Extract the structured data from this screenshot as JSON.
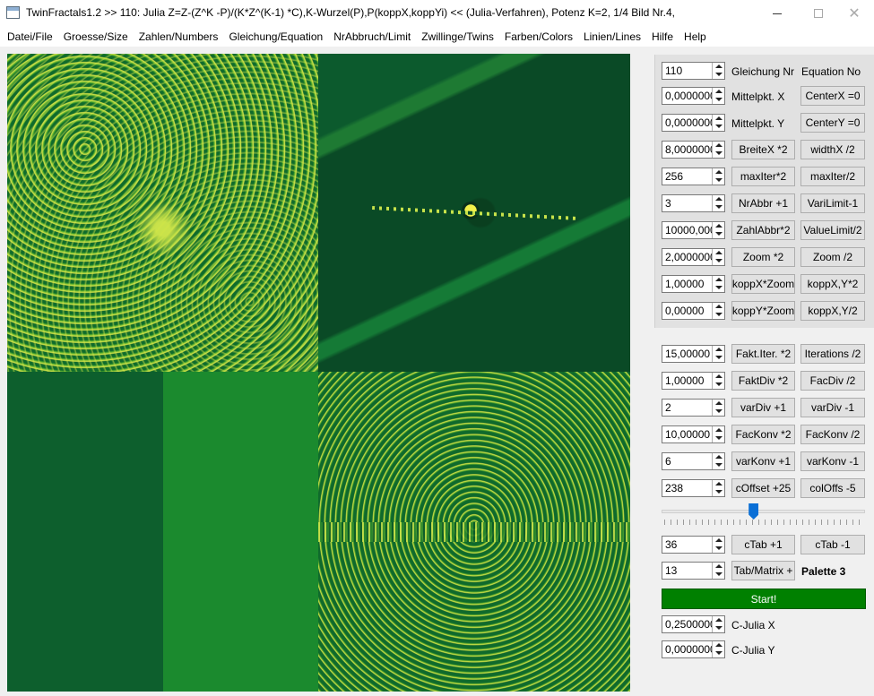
{
  "window": {
    "title": "TwinFractals1.2 >> 110: Julia Z=Z-(Z^K -P)/(K*Z^(K-1) *C),K-Wurzel(P),P(koppX,koppYi)  << (Julia-Verfahren), Potenz K=2, 1/4 Bild Nr.4,",
    "minimize": "—",
    "close": "✕"
  },
  "menu": [
    "Datei/File",
    "Groesse/Size",
    "Zahlen/Numbers",
    "Gleichung/Equation",
    "NrAbbruch/Limit",
    "Zwillinge/Twins",
    "Farben/Colors",
    "Linien/Lines",
    "Hilfe",
    "Help"
  ],
  "rows1": [
    {
      "value": "110",
      "label": "Gleichung Nr",
      "label2": "Equation No"
    },
    {
      "value": "0,0000000",
      "label": "Mittelpkt. X",
      "btn2": "CenterX =0"
    },
    {
      "value": "0,0000000",
      "label": "Mittelpkt. Y",
      "btn2": "CenterY =0"
    },
    {
      "value": "8,0000000",
      "btn1": "BreiteX *2",
      "btn2": "widthX /2"
    },
    {
      "value": "256",
      "btn1": "maxIter*2",
      "btn2": "maxIter/2"
    },
    {
      "value": "3",
      "btn1": "NrAbbr +1",
      "btn2": "VariLimit-1"
    },
    {
      "value": "10000,000",
      "btn1": "ZahlAbbr*2",
      "btn2": "ValueLimit/2"
    },
    {
      "value": "2,0000000",
      "btn1": "Zoom *2",
      "btn2": "Zoom /2"
    },
    {
      "value": "1,00000",
      "btn1": "koppX*Zoom",
      "btn2": "koppX,Y*2"
    },
    {
      "value": "0,00000",
      "btn1": "koppY*Zoom",
      "btn2": "koppX,Y/2"
    }
  ],
  "rows2": [
    {
      "value": "15,00000",
      "btn1": "Fakt.Iter. *2",
      "btn2": "Iterations /2"
    },
    {
      "value": "1,00000",
      "btn1": "FaktDiv *2",
      "btn2": "FacDiv /2"
    },
    {
      "value": "2",
      "btn1": "varDiv +1",
      "btn2": "varDiv -1"
    },
    {
      "value": "10,00000",
      "btn1": "FacKonv *2",
      "btn2": "FacKonv /2"
    },
    {
      "value": "6",
      "btn1": "varKonv +1",
      "btn2": "varKonv -1"
    },
    {
      "value": "238",
      "btn1": "cOffset +25",
      "btn2": "colOffs -5"
    }
  ],
  "slider": {
    "fraction": 0.45
  },
  "ctab": {
    "value": "36",
    "btn1": "cTab +1",
    "btn2": "cTab -1"
  },
  "matrix": {
    "value": "13",
    "btn1": "Tab/Matrix +",
    "label": "Palette 3"
  },
  "start": "Start!",
  "julia": [
    {
      "value": "0,2500000",
      "label": "C-Julia X"
    },
    {
      "value": "0,0000000",
      "label": "C-Julia Y"
    }
  ]
}
